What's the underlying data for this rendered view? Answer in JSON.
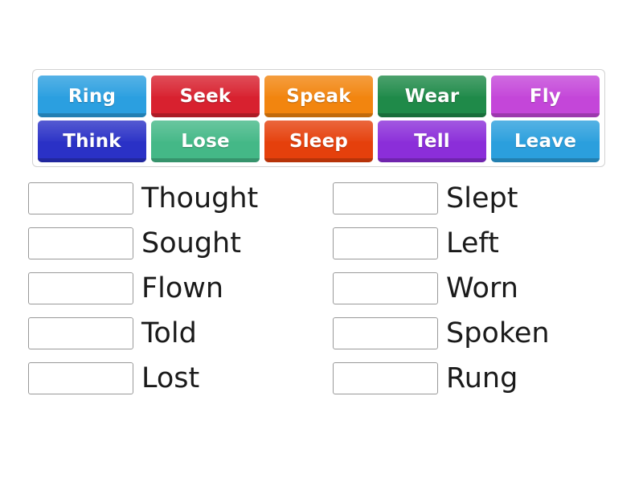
{
  "activity": {
    "type": "match-up",
    "tray": {
      "rows": [
        [
          {
            "label": "Ring",
            "color": "#2b9fe0"
          },
          {
            "label": "Seek",
            "color": "#d8212f"
          },
          {
            "label": "Speak",
            "color": "#f2850f"
          },
          {
            "label": "Wear",
            "color": "#1f8a49"
          },
          {
            "label": "Fly",
            "color": "#c446d9"
          }
        ],
        [
          {
            "label": "Think",
            "color": "#2a31c6"
          },
          {
            "label": "Lose",
            "color": "#44b887"
          },
          {
            "label": "Sleep",
            "color": "#e5400c"
          },
          {
            "label": "Tell",
            "color": "#8b2ed9"
          },
          {
            "label": "Leave",
            "color": "#2b9fdd"
          }
        ]
      ]
    },
    "answers": {
      "left_column": [
        {
          "placeholder": "",
          "text": "Thought"
        },
        {
          "placeholder": "",
          "text": "Sought"
        },
        {
          "placeholder": "",
          "text": "Flown"
        },
        {
          "placeholder": "",
          "text": "Told"
        },
        {
          "placeholder": "",
          "text": "Lost"
        }
      ],
      "right_column": [
        {
          "placeholder": "",
          "text": "Slept"
        },
        {
          "placeholder": "",
          "text": "Left"
        },
        {
          "placeholder": "",
          "text": "Worn"
        },
        {
          "placeholder": "",
          "text": "Spoken"
        },
        {
          "placeholder": "",
          "text": "Rung"
        }
      ]
    },
    "colors": {
      "page_background": "#ffffff",
      "tray_border": "#d2d2d2",
      "drop_box_border": "#999999",
      "answer_text": "#1a1a1a",
      "tile_text": "#ffffff"
    }
  }
}
